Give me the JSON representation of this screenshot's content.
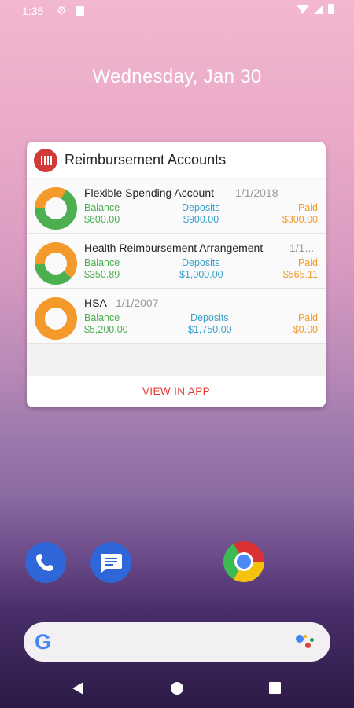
{
  "status_bar": {
    "time": "1:35",
    "icons": [
      "settings-icon",
      "sd-card-icon",
      "wifi-icon",
      "signal-icon",
      "battery-icon"
    ]
  },
  "lockscreen": {
    "date": "Wednesday, Jan 30"
  },
  "widget": {
    "title": "Reimbursement Accounts",
    "logo_icon": "app-logo-icon",
    "column_labels": {
      "balance": "Balance",
      "deposits": "Deposits",
      "paid": "Paid"
    },
    "accounts": [
      {
        "name": "Flexible Spending Account",
        "date": "1/1/2018",
        "balance": "$600.00",
        "deposits": "$900.00",
        "paid": "$300.00",
        "paid_fraction": 0.33
      },
      {
        "name": "Health Reimbursement Arrangement",
        "date": "1/1...",
        "balance": "$350.89",
        "deposits": "$1,000.00",
        "paid": "$565.11",
        "paid_fraction": 0.62
      },
      {
        "name": "HSA",
        "date": "1/1/2007",
        "balance": "$5,200.00",
        "deposits": "$1,750.00",
        "paid": "$0.00",
        "paid_fraction": 1.0
      }
    ],
    "footer_button": "VIEW IN APP",
    "colors": {
      "balance": "#4caf50",
      "deposits": "#3aa0c8",
      "paid": "#f39a2a",
      "accent": "#e53935"
    }
  },
  "dock": {
    "apps": [
      "phone-icon",
      "messages-icon",
      "chrome-icon"
    ]
  },
  "search_bar": {
    "logo": "G",
    "assistant_icon": "google-assistant-icon"
  },
  "navigation": [
    "back-icon",
    "home-icon",
    "recents-icon"
  ]
}
